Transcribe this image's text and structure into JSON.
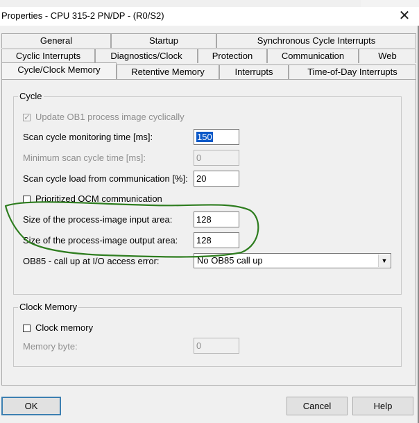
{
  "window": {
    "title": "Properties - CPU 315-2 PN/DP - (R0/S2)",
    "close_glyph": "✕"
  },
  "tabs": {
    "row1": [
      "General",
      "Startup",
      "Synchronous Cycle Interrupts"
    ],
    "row2": [
      "Cyclic Interrupts",
      "Diagnostics/Clock",
      "Protection",
      "Communication",
      "Web"
    ],
    "row3": [
      "Cycle/Clock Memory",
      "Retentive Memory",
      "Interrupts",
      "Time-of-Day Interrupts"
    ],
    "active": "Cycle/Clock Memory"
  },
  "cycle": {
    "title": "Cycle",
    "update_ob1_label": "Update OB1 process image cyclically",
    "update_ob1_checked": true,
    "scan_monitoring_label": "Scan cycle monitoring time [ms]:",
    "scan_monitoring_value": "150",
    "min_scan_label": "Minimum scan cycle time [ms]:",
    "min_scan_value": "0",
    "load_comm_label": "Scan cycle load from communication [%]:",
    "load_comm_value": "20",
    "prioritized_ocm_label": "Prioritized OCM communication",
    "prioritized_ocm_checked": false,
    "input_area_label": "Size of the process-image input area:",
    "input_area_value": "128",
    "output_area_label": "Size of the process-image output area:",
    "output_area_value": "128",
    "ob85_label": "OB85 - call up at I/O access error:",
    "ob85_value": "No OB85 call up"
  },
  "clock_memory": {
    "title": "Clock Memory",
    "clock_memory_label": "Clock memory",
    "clock_memory_checked": false,
    "memory_byte_label": "Memory byte:",
    "memory_byte_value": "0"
  },
  "footer": {
    "ok_label": "OK",
    "cancel_label": "Cancel",
    "help_label": "Help"
  },
  "colors": {
    "annotation": "#2e7d1f",
    "selection": "#0a58c8"
  }
}
